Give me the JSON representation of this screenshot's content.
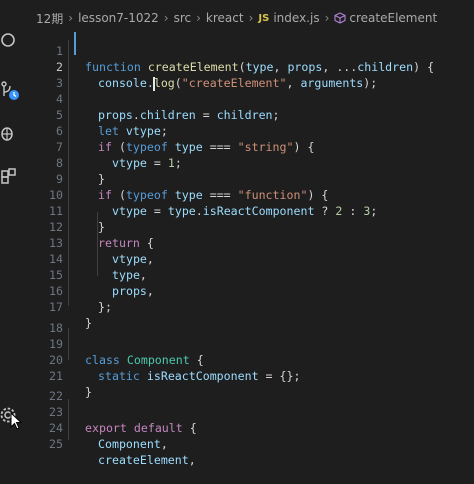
{
  "breadcrumb": {
    "items": [
      "12期",
      "lesson7-1022",
      "src",
      "kreact",
      "index.js",
      "createElement"
    ],
    "file_badge": "JS"
  },
  "editor": {
    "line_numbers": [
      "1",
      "2",
      "3",
      "4",
      "5",
      "6",
      "7",
      "8",
      "9",
      "10",
      "11",
      "12",
      "13",
      "14",
      "15",
      "16",
      "17",
      "18",
      "19",
      "20",
      "21",
      "22",
      "23",
      "24",
      "25"
    ],
    "lines": {
      "l1": {
        "t1": "function ",
        "t2": "createElement",
        "t3": "(",
        "t4": "type",
        "t5": ", ",
        "t6": "props",
        "t7": ", ...",
        "t8": "children",
        "t9": ") {"
      },
      "l2a": "console.",
      "l2b": "log",
      "l2c": "(",
      "l2d": "\"createElement\"",
      "l2e": ", ",
      "l2f": "arguments",
      "l2g": ");",
      "l4": {
        "a": "props",
        "b": ".",
        "c": "children",
        "d": " = ",
        "e": "children",
        "f": ";"
      },
      "l5": {
        "a": "let ",
        "b": "vtype",
        "c": ";"
      },
      "l6": {
        "a": "if ",
        "b": "(",
        "c": "typeof ",
        "d": "type",
        "e": " === ",
        "f": "\"string\"",
        "g": ") {"
      },
      "l7": {
        "a": "vtype",
        "b": " = ",
        "c": "1",
        "d": ";"
      },
      "l8": "}",
      "l9": {
        "a": "if ",
        "b": "(",
        "c": "typeof ",
        "d": "type",
        "e": " === ",
        "f": "\"function\"",
        "g": ") {"
      },
      "l10": {
        "a": "vtype",
        "b": " = ",
        "c": "type",
        "d": ".",
        "e": "isReactComponent",
        "f": " ? ",
        "g": "2",
        "h": " : ",
        "i": "3",
        "j": ";"
      },
      "l11": "}",
      "l12": {
        "a": "return ",
        "b": "{"
      },
      "l13": {
        "a": "vtype",
        "b": ","
      },
      "l14": {
        "a": "type",
        "b": ","
      },
      "l15": {
        "a": "props",
        "b": ","
      },
      "l16": "};",
      "l17": "}",
      "l19": {
        "a": "class ",
        "b": "Component",
        "c": " {"
      },
      "l20": {
        "a": "static ",
        "b": "isReactComponent",
        "c": " = {};"
      },
      "l21": "}",
      "l23": {
        "a": "export ",
        "b": "default ",
        "c": "{"
      },
      "l24": {
        "a": "Component",
        "b": ","
      },
      "l25": {
        "a": "createElement",
        "b": ","
      }
    }
  },
  "colors": {
    "background": "#1e1e1e",
    "keyword": "#569cd6",
    "control": "#c586c0",
    "function": "#dcdcaa",
    "variable": "#9cdcfe",
    "string": "#ce9178",
    "number": "#b5cea8",
    "class": "#4ec9b0",
    "line_number": "#6e7681"
  },
  "icons": [
    "search-icon",
    "source-control-icon",
    "debug-icon",
    "extensions-icon",
    "settings-gear-icon"
  ]
}
